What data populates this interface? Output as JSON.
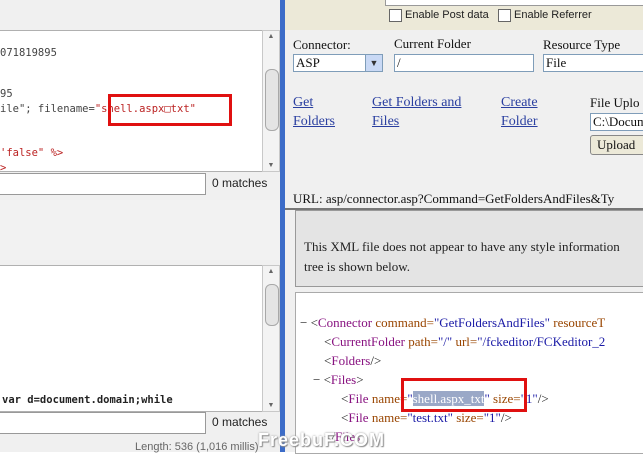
{
  "left_panel": {
    "code_top_lines": [
      "071819895",
      "95",
      "ile\"; filename=\"shell.aspx□txt\"",
      "'false\" %>",
      ">"
    ],
    "code_top": {
      "id_fragment": "071819895",
      "line2_fragment": "95",
      "filename_prefix": "ile\"; filename=",
      "filename_value": "\"shell.aspx□txt\"",
      "false_fragment": "'false\" %>",
      "tail_fragment": ">"
    },
    "code_bottom_line": "var d=document.domain;while",
    "matches_top": "0 matches",
    "matches_bottom": "0 matches",
    "length_text": "Length: 536 (1,016 millis)"
  },
  "right_panel": {
    "checkboxes": [
      {
        "label": "Enable Post data"
      },
      {
        "label": "Enable Referrer"
      }
    ],
    "connector": {
      "label": "Connector:",
      "value": "ASP"
    },
    "current_folder": {
      "label": "Current Folder",
      "value": "/"
    },
    "resource_type": {
      "label": "Resource Type",
      "value": "File"
    },
    "links": {
      "get_folders": [
        "Get",
        "Folders"
      ],
      "get_folders_files": [
        "Get Folders and",
        "Files"
      ],
      "create_folder": [
        "Create",
        "Folder"
      ]
    },
    "file_upload": {
      "label": "File Uplo",
      "path_value": "C:\\Docum",
      "button": "Upload"
    },
    "url_line": "URL: asp/connector.asp?Command=GetFoldersAndFiles&Ty",
    "notice_lines": [
      "This XML file does not appear to have any style information",
      "tree is shown below."
    ],
    "xml": {
      "connector_prefix": "− <",
      "connector_tag": "Connector",
      "connector_attr1": " command=",
      "connector_val1": "\"GetFoldersAndFiles\"",
      "connector_attr2": " resourceT",
      "current_folder_tag": "CurrentFolder",
      "cf_attr1": " path=",
      "cf_val1": "\"/\"",
      "cf_attr2": " url=",
      "cf_val2": "\"/fckeditor/FCKeditor_2",
      "folders_tag": "Folders",
      "files_tag": "Files",
      "file_tag": "File",
      "file_name_attr": " name=",
      "file1_name": "shell.aspx_txt",
      "file1_size_attr": " size=",
      "file1_size": "\"1\"",
      "file2_name": "\"test.txt\"",
      "file2_size_attr": " size=",
      "file2_size": "\"1\""
    }
  },
  "watermark": "FreebuF.COM",
  "colors": {
    "divider": "#3c6cc8",
    "highlight_box": "#e01010",
    "link": "#2a3fa0"
  }
}
